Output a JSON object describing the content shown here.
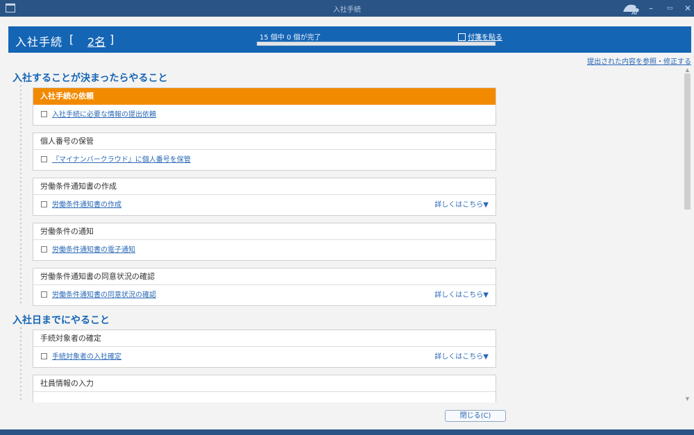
{
  "window": {
    "title": "入社手続",
    "ai_badge": "AI",
    "minimize": "–",
    "restore": "▭",
    "close": "✕"
  },
  "header": {
    "title": "入社手続",
    "bracket_open": "[",
    "count": "2名",
    "bracket_close": "]",
    "progress_text": "15 個中 0 個が完了",
    "progress": 0,
    "sticky_label": "付箋を貼る"
  },
  "reference_link": "提出された内容を参照・修正する",
  "sections": [
    {
      "title": "入社することが決まったらやること",
      "cards": [
        {
          "heading": "入社手続の依頼",
          "highlight": true,
          "task": "入社手続に必要な情報の提出依頼",
          "detail": ""
        },
        {
          "heading": "個人番号の保管",
          "highlight": false,
          "task": "『マイナンバークラウド』に個人番号を保管",
          "detail": ""
        },
        {
          "heading": "労働条件通知書の作成",
          "highlight": false,
          "task": "労働条件通知書の作成",
          "detail": "詳しくはこちら▼"
        },
        {
          "heading": "労働条件の通知",
          "highlight": false,
          "task": "労働条件通知書の電子通知",
          "detail": ""
        },
        {
          "heading": "労働条件通知書の同意状況の確認",
          "highlight": false,
          "task": "労働条件通知書の同意状況の確認",
          "detail": "詳しくはこちら▼"
        }
      ]
    },
    {
      "title": "入社日までにやること",
      "cards": [
        {
          "heading": "手続対象者の確定",
          "highlight": false,
          "task": "手続対象者の入社確定",
          "detail": "詳しくはこちら▼"
        },
        {
          "heading": "社員情報の入力",
          "highlight": false,
          "task": "",
          "detail": ""
        }
      ]
    }
  ],
  "close_button": "閉じる(C)",
  "colors": {
    "titlebar": "#2a5486",
    "header": "#1565b5",
    "accent_orange": "#f28a00",
    "link": "#2a68b6"
  }
}
